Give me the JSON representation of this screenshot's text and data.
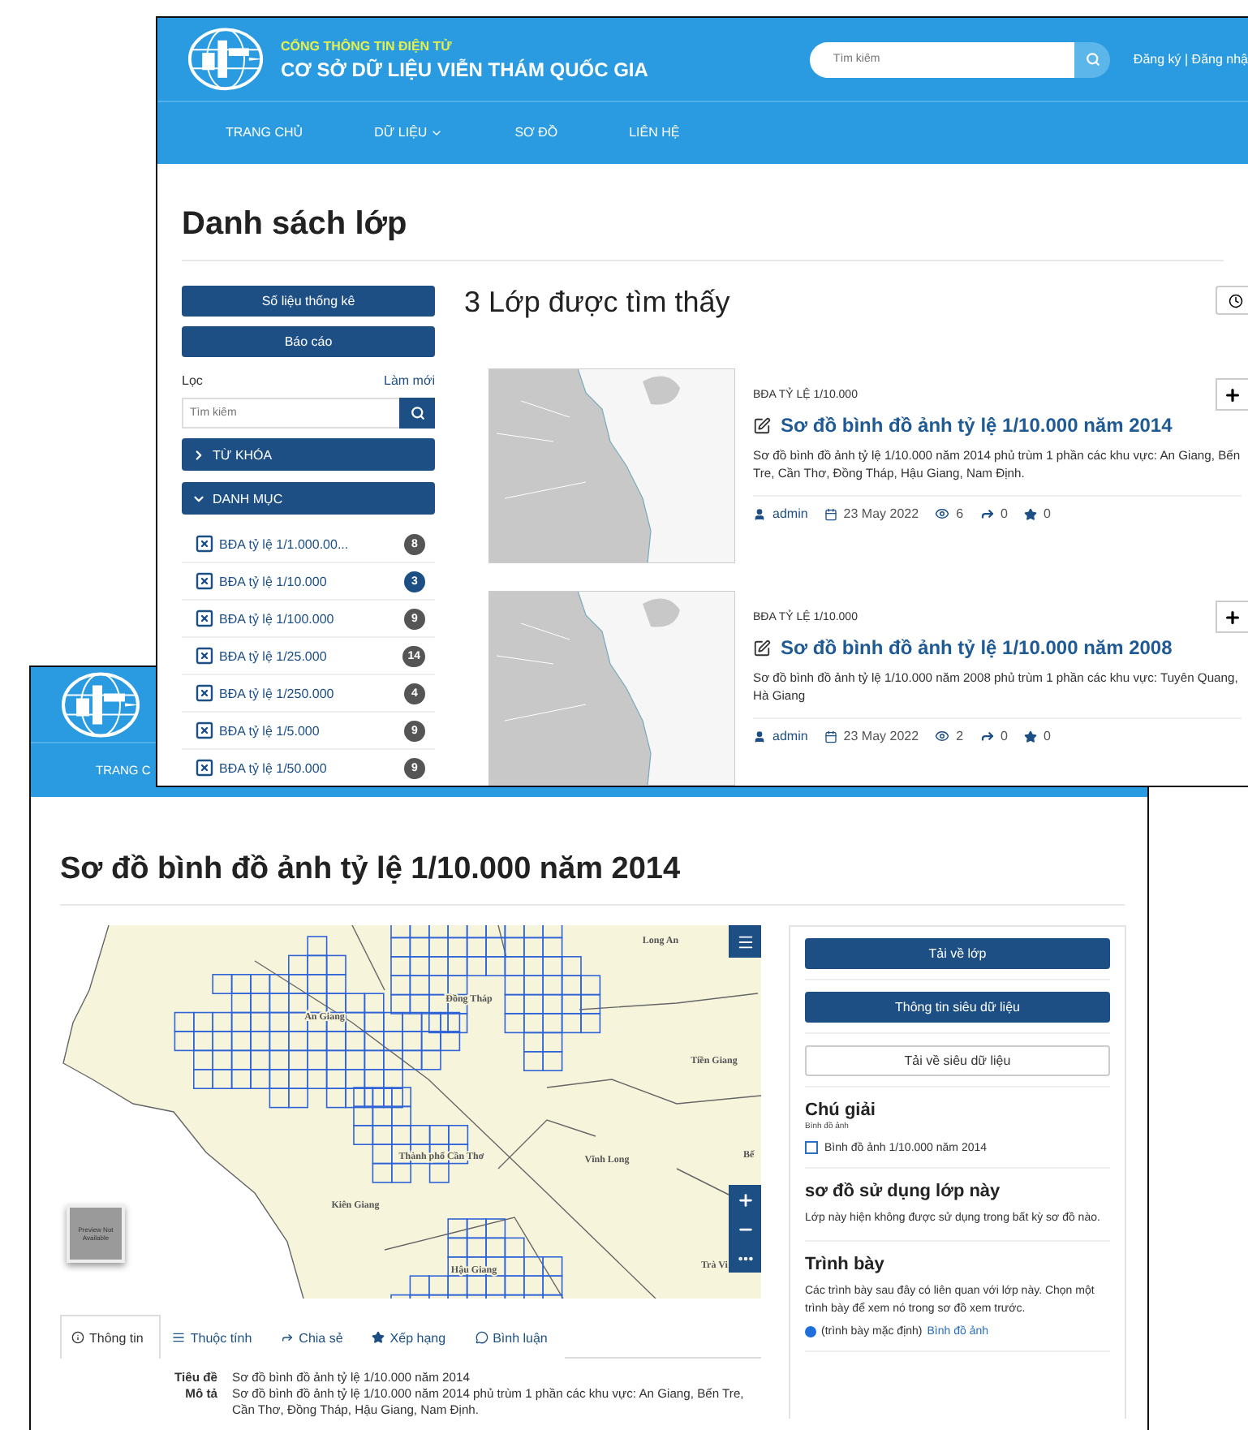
{
  "list_window": {
    "header": {
      "tagline": "CỔNG THÔNG TIN ĐIỆN TỬ",
      "site_title": "CƠ SỞ DỮ LIỆU VIỄN THÁM QUỐC GIA",
      "search": {
        "placeholder": "Tìm kiếm"
      },
      "account_links": "Đăng ký | Đăng nhậ"
    },
    "nav": [
      {
        "label": "TRANG CHỦ",
        "dropdown": false
      },
      {
        "label": "DỮ LIỆU",
        "dropdown": true
      },
      {
        "label": "SƠ ĐỒ",
        "dropdown": false
      },
      {
        "label": "LIÊN HỆ",
        "dropdown": false
      }
    ],
    "page_title": "Danh sách lớp",
    "sidebar": {
      "buttons": [
        "Số liệu thống kê",
        "Báo cáo"
      ],
      "filter_label": "Lọc",
      "reset_link": "Làm mới",
      "search": {
        "placeholder": "Tìm kiếm"
      },
      "sections": [
        {
          "label": "TỪ KHÓA",
          "expanded": false
        },
        {
          "label": "DANH MỤC",
          "expanded": true
        }
      ],
      "categories": [
        {
          "label": "BĐA tỷ lệ 1/1.000.00...",
          "count": "8",
          "selected": false
        },
        {
          "label": "BĐA tỷ lệ 1/10.000",
          "count": "3",
          "selected": true
        },
        {
          "label": "BĐA tỷ lệ 1/100.000",
          "count": "9",
          "selected": false
        },
        {
          "label": "BĐA tỷ lệ 1/25.000",
          "count": "14",
          "selected": false
        },
        {
          "label": "BĐA tỷ lệ 1/250.000",
          "count": "4",
          "selected": false
        },
        {
          "label": "BĐA tỷ lệ 1/5.000",
          "count": "9",
          "selected": false
        },
        {
          "label": "BĐA tỷ lệ 1/50.000",
          "count": "9",
          "selected": false
        }
      ]
    },
    "results_heading": "3 Lớp được tìm thấy",
    "layers": [
      {
        "category": "BĐA TỶ LỆ 1/10.000",
        "title": "Sơ đồ bình đồ ảnh tỷ lệ 1/10.000 năm 2014",
        "description": "Sơ đồ bình đồ ảnh tỷ lệ 1/10.000 năm 2014 phủ trùm 1 phần các khu vực: An Giang, Bến Tre, Cần Thơ, Đồng Tháp, Hậu Giang, Nam Định.",
        "author": "admin",
        "date": "23 May 2022",
        "views": "6",
        "shares": "0",
        "rating": "0"
      },
      {
        "category": "BĐA TỶ LỆ 1/10.000",
        "title": "Sơ đồ bình đồ ảnh tỷ lệ 1/10.000 năm 2008",
        "description": "Sơ đồ bình đồ ảnh tỷ lệ 1/10.000 năm 2008 phủ trùm 1 phần các khu vực: Tuyên Quang, Hà Giang",
        "author": "admin",
        "date": "23 May 2022",
        "views": "2",
        "shares": "0",
        "rating": "0"
      }
    ]
  },
  "map_window": {
    "nav": [
      {
        "label": "TRANG C"
      }
    ],
    "title": "Sơ đồ bình đồ ảnh tỷ lệ 1/10.000 năm 2014",
    "map": {
      "labels": [
        {
          "text": "Long An"
        },
        {
          "text": "Đồng Tháp"
        },
        {
          "text": "An Giang"
        },
        {
          "text": "Tiền Giang"
        },
        {
          "text": "Thành phố Cần Thơ"
        },
        {
          "text": "Vĩnh Long"
        },
        {
          "text": "Bế"
        },
        {
          "text": "Kiên Giang"
        },
        {
          "text": "Trà Vi"
        },
        {
          "text": "Hậu Giang"
        }
      ],
      "preview_label": "Preview Not Available"
    },
    "actions": [
      {
        "label": "Tải về lớp",
        "kind": "primary"
      },
      {
        "label": "Thông tin siêu dữ liệu",
        "kind": "primary"
      },
      {
        "label": "Tải về siêu dữ liệu",
        "kind": "outline"
      }
    ],
    "legend": {
      "title": "Chú giải",
      "subtitle": "Bình đồ ảnh",
      "items": [
        {
          "label": "Bình đồ ảnh 1/10.000 năm 2014",
          "checked": false
        }
      ]
    },
    "maps_using": {
      "title": "sơ đồ sử dụng lớp này",
      "text": "Lớp này hiện không được sử dụng trong bất kỳ sơ đồ nào."
    },
    "styles": {
      "title": "Trình bày",
      "text": "Các trình bày sau đây có liên quan với lớp này. Chọn một trình bày để xem nó trong sơ đồ xem trước.",
      "options": [
        {
          "prefix": "(trình bày mặc định)",
          "link": "Bình đồ ảnh",
          "selected": true
        }
      ]
    },
    "tabs": [
      {
        "label": "Thông tin",
        "kind": "info",
        "selected": true
      },
      {
        "label": "Thuộc tính",
        "kind": "attributes",
        "selected": false
      },
      {
        "label": "Chia sẻ",
        "kind": "share",
        "selected": false
      },
      {
        "label": "Xếp hạng",
        "kind": "rating",
        "selected": false
      },
      {
        "label": "Bình luận",
        "kind": "comments",
        "selected": false
      }
    ],
    "info": [
      {
        "label": "Tiêu đề",
        "value": "Sơ đồ bình đồ ảnh tỷ lệ 1/10.000 năm 2014"
      },
      {
        "label": "Mô tả",
        "value": "Sơ đồ bình đồ ảnh tỷ lệ 1/10.000 năm 2014 phủ trùm 1 phần các khu vực: An Giang, Bến Tre, Cần Thơ, Đồng Tháp, Hậu Giang, Nam Định."
      }
    ]
  }
}
